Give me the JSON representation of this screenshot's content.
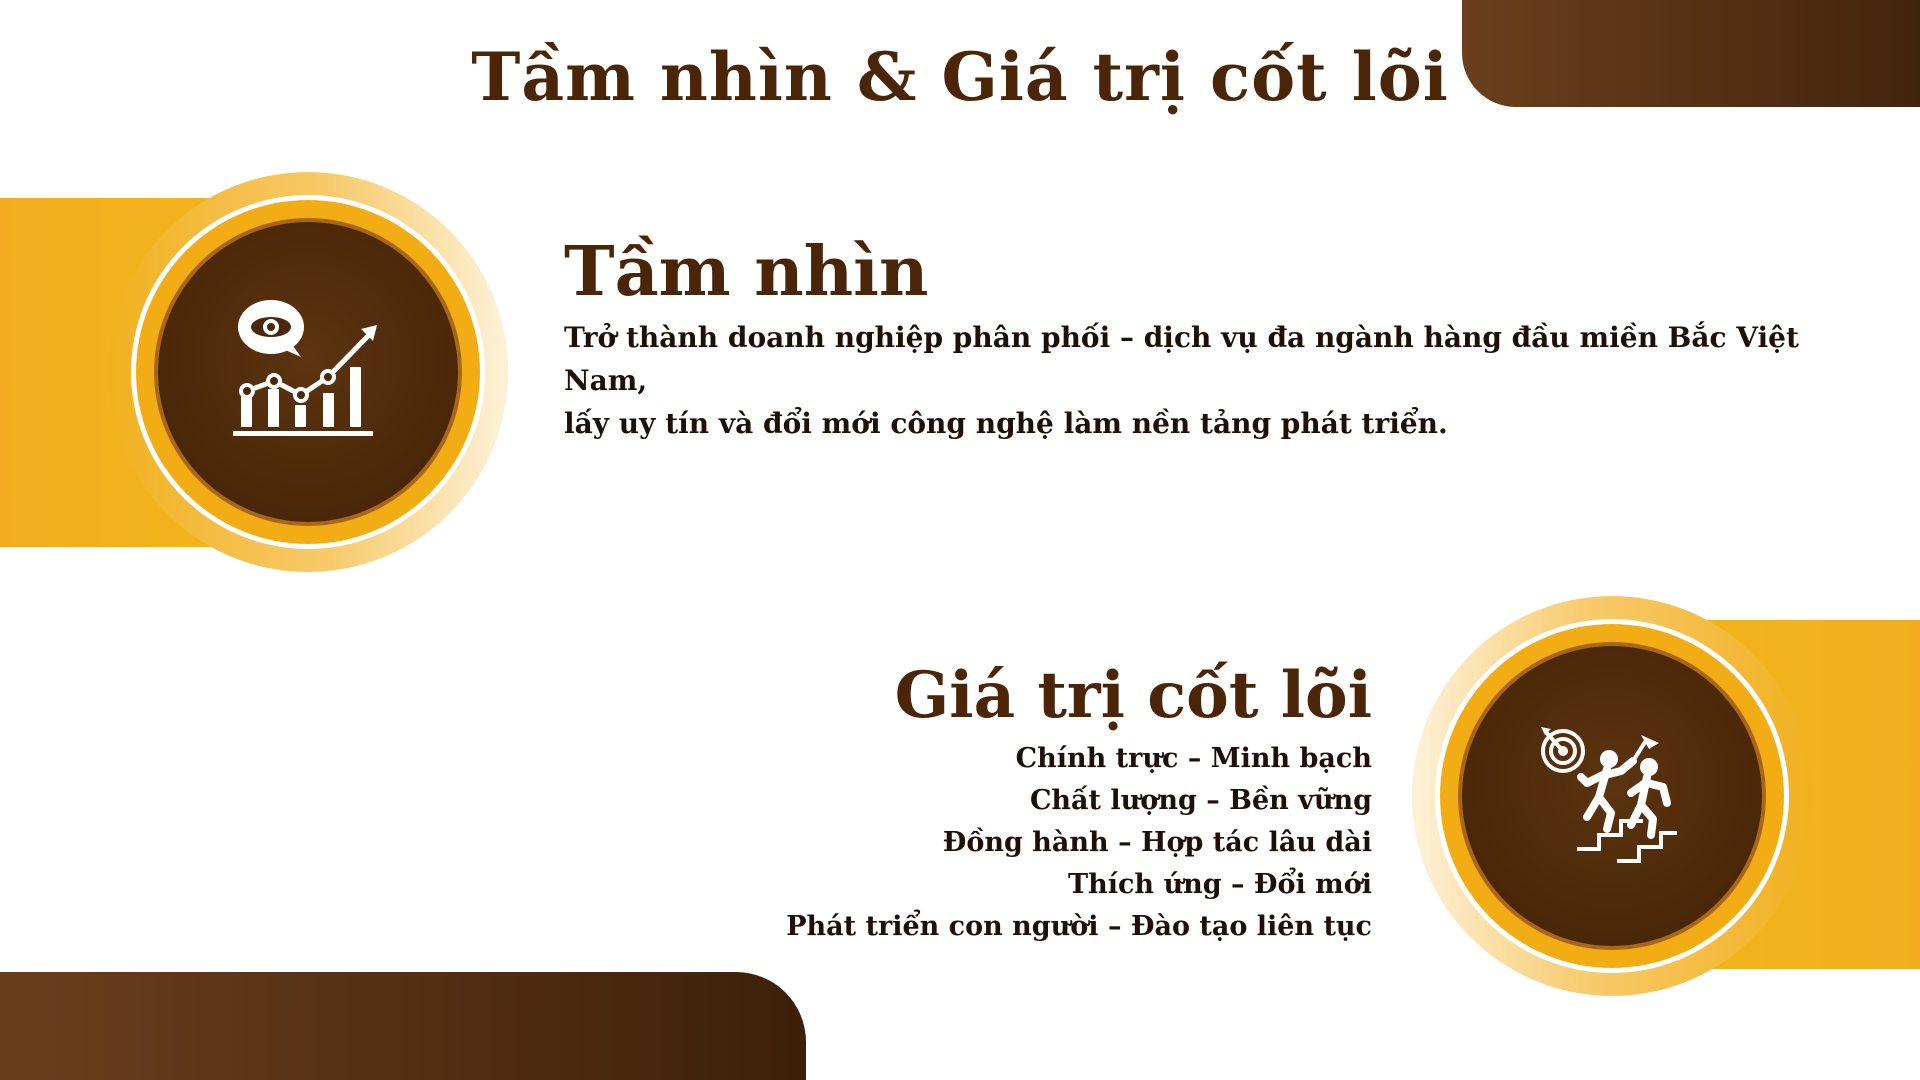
{
  "title": "Tầm nhìn & Giá trị cốt lõi",
  "vision": {
    "heading": "Tầm nhìn",
    "lines": [
      "Trở thành doanh nghiệp phân phối – dịch vụ đa ngành hàng đầu miền Bắc Việt Nam,",
      "lấy uy tín và đổi mới công nghệ làm nền tảng phát triển."
    ],
    "icon": "vision-growth-chart-icon"
  },
  "core_values": {
    "heading": "Giá trị cốt lõi",
    "items": [
      "Chính trực – Minh bạch",
      "Chất lượng – Bền vững",
      "Đồng hành – Hợp tác lâu dài",
      "Thích ứng – Đổi mới",
      "Phát triển con người – Đào tạo liên tục"
    ],
    "icon": "goal-climbing-team-icon"
  },
  "colors": {
    "brown_dark": "#4a2508",
    "gold": "#f2ad14",
    "text": "#1e1006"
  }
}
